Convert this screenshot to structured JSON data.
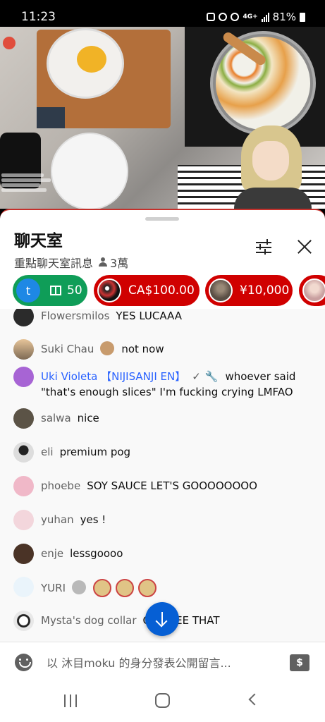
{
  "status_bar": {
    "time": "11:23",
    "network": "4G+",
    "battery": "81%"
  },
  "chat": {
    "title": "聊天室",
    "mode_label": "重點聊天室訊息",
    "viewer_count": "3萬"
  },
  "ticker": [
    {
      "type": "membership",
      "avatar_letter": "t",
      "value": "50",
      "color": "#0f9d58"
    },
    {
      "type": "superchat",
      "value": "CA$100.00",
      "color": "#d00000"
    },
    {
      "type": "superchat",
      "value": "¥10,000",
      "color": "#d00000"
    }
  ],
  "messages": [
    {
      "author": "Flowersmilos",
      "text": "YES LUCAAA",
      "avatar_color": "#2b2b2b"
    },
    {
      "author": "Suki Chau",
      "text": "not now",
      "avatar_color": "#c89b6d",
      "badge": true
    },
    {
      "author": "Uki Violeta 【NIJISANJI EN】",
      "text": "whoever said \"that's enough slices\" I'm fucking crying LMFAO",
      "avatar_color": "#a764d4",
      "member": true
    },
    {
      "author": "salwa",
      "text": "nice",
      "avatar_color": "#5b5346"
    },
    {
      "author": "eli",
      "text": "premium pog",
      "avatar_color": "#d9d9d9"
    },
    {
      "author": "phoebe",
      "text": "SOY SAUCE LET'S GOOOOOOOO",
      "avatar_color": "#f0b8c8"
    },
    {
      "author": "yuhan",
      "text": "yes !",
      "avatar_color": "#f3d6dc"
    },
    {
      "author": "enje",
      "text": "lessgoooo",
      "avatar_color": "#4a3326"
    },
    {
      "author": "YURI",
      "text": "",
      "avatar_color": "#eaf4fb",
      "badge": true,
      "emotes": 3
    },
    {
      "author": "Mysta's dog collar",
      "text": "OH I SEE THAT",
      "avatar_color": "#e8e8e8"
    }
  ],
  "composer": {
    "placeholder": "以 沐目moku 的身分發表公開留言..."
  },
  "icons": {
    "filter": "tune-icon",
    "close": "close-icon",
    "emoji": "emoji-icon",
    "super_chat": "super-chat-icon",
    "scroll": "arrow-down-icon"
  }
}
